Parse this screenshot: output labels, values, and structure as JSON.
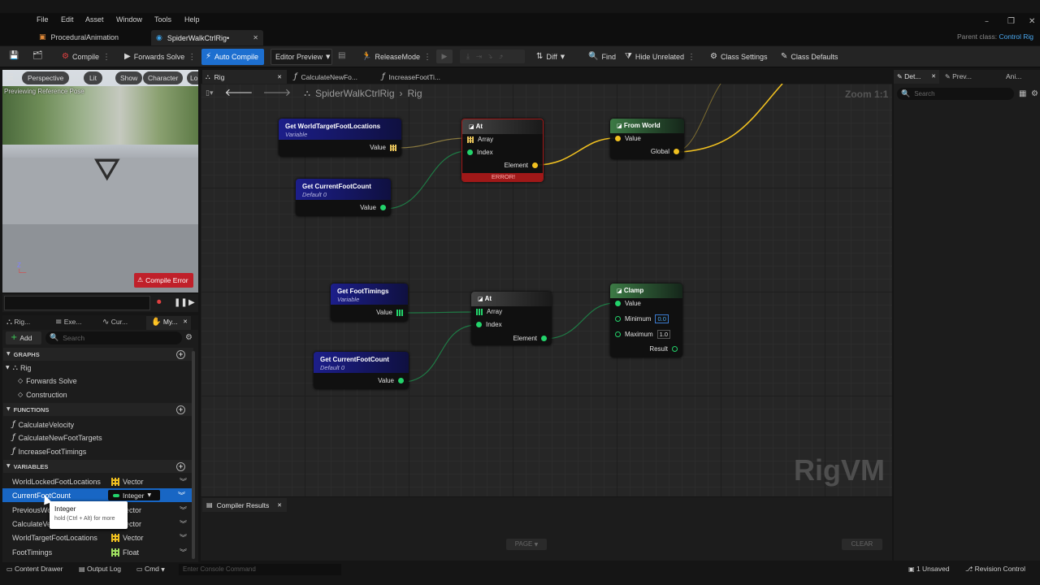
{
  "menu": [
    "File",
    "Edit",
    "Asset",
    "Window",
    "Tools",
    "Help"
  ],
  "tabs": [
    {
      "label": "ProceduralAnimation"
    },
    {
      "label": "SpiderWalkCtrlRig•"
    }
  ],
  "parent_class": {
    "label": "Parent class:",
    "value": "Control Rig"
  },
  "toolbar": {
    "compile": "Compile",
    "forwards_solve": "Forwards Solve",
    "auto_compile": "Auto Compile",
    "editor_preview": "Editor Preview",
    "release_mode": "ReleaseMode",
    "diff": "Diff",
    "find": "Find",
    "hide_unrelated": "Hide Unrelated",
    "class_settings": "Class Settings",
    "class_defaults": "Class Defaults"
  },
  "viewport": {
    "perspective": "Perspective",
    "lit": "Lit",
    "show": "Show",
    "character": "Character",
    "lo": "Lo",
    "previewing": "Previewing Reference Pose",
    "compile_error": "Compile Error"
  },
  "graph_tabs": [
    {
      "label": "Rig"
    },
    {
      "label": "CalculateNewFo..."
    },
    {
      "label": "IncreaseFootTi..."
    }
  ],
  "breadcrumb": {
    "rig_name": "SpiderWalkCtrlRig",
    "sep": "›",
    "graph": "Rig"
  },
  "zoom": "Zoom 1:1",
  "watermark": "RigVM",
  "nodes": {
    "n1": {
      "title": "Get WorldTargetFootLocations",
      "sub": "Variable",
      "pin": "Value"
    },
    "n2": {
      "title": "Get CurrentFootCount",
      "sub": "Default 0",
      "pin": "Value"
    },
    "n3": {
      "title": "At",
      "array": "Array",
      "index": "Index",
      "element": "Element",
      "error": "ERROR!"
    },
    "n4": {
      "title": "From World",
      "value": "Value",
      "global": "Global"
    },
    "n5": {
      "title": "Get FootTimings",
      "sub": "Variable",
      "pin": "Value"
    },
    "n6": {
      "title": "Get CurrentFootCount",
      "sub": "Default 0",
      "pin": "Value"
    },
    "n7": {
      "title": "At",
      "array": "Array",
      "index": "Index",
      "element": "Element"
    },
    "n8": {
      "title": "Clamp",
      "value": "Value",
      "minimum": "Minimum",
      "min_val": "0.0",
      "maximum": "Maximum",
      "max_val": "1.0",
      "result": "Result"
    }
  },
  "bottom_tab": "Compiler Results",
  "page_btn": "PAGE",
  "clear_btn": "CLEAR",
  "left_tabs": [
    "Rig...",
    "Exe...",
    "Cur...",
    "My..."
  ],
  "add_label": "Add",
  "search_placeholder": "Search",
  "sections": {
    "graphs": "GRAPHS",
    "functions": "FUNCTIONS",
    "variables": "VARIABLES"
  },
  "graphs": {
    "rig": "Rig",
    "forwards": "Forwards Solve",
    "construction": "Construction"
  },
  "functions": [
    "CalculateVelocity",
    "CalculateNewFootTargets",
    "IncreaseFootTimings"
  ],
  "variables": [
    {
      "name": "WorldLockedFootLocations",
      "type": "Vector"
    },
    {
      "name": "CurrentFootCount",
      "type": "Integer"
    },
    {
      "name": "PreviousWo",
      "type": "ector"
    },
    {
      "name": "CalculateVe",
      "type": "ector"
    },
    {
      "name": "WorldTargetFootLocations",
      "type": "Vector"
    },
    {
      "name": "FootTimings",
      "type": "Float"
    }
  ],
  "tooltip": {
    "title": "Integer",
    "hint": "hold (Ctrl + Alt) for more"
  },
  "right_tabs": [
    "Det...",
    "Prev...",
    "Ani..."
  ],
  "right_search": "Search",
  "status": {
    "content_drawer": "Content Drawer",
    "output_log": "Output Log",
    "cmd": "Cmd",
    "console": "Enter Console Command",
    "unsaved": "1 Unsaved",
    "revision": "Revision Control"
  }
}
